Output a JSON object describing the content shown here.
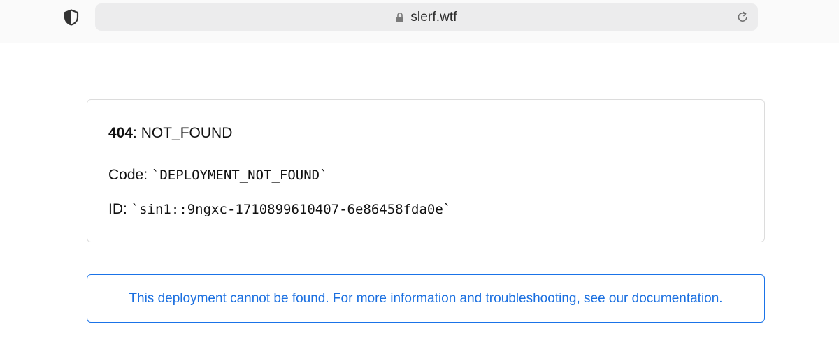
{
  "browser": {
    "url": "slerf.wtf",
    "icons": {
      "shield": "shield-icon",
      "lock": "lock-icon",
      "reload": "reload-icon"
    }
  },
  "error": {
    "status_code": "404",
    "status_separator": ": ",
    "status_text": "NOT_FOUND",
    "code_label": "Code: ",
    "code_value": "`DEPLOYMENT_NOT_FOUND`",
    "id_label": "ID: ",
    "id_value": "`sin1::9ngxc-1710899610407-6e86458fda0e`"
  },
  "notice": {
    "text": "This deployment cannot be found. For more information and troubleshooting, see our documentation."
  },
  "colors": {
    "accent": "#1a73e8",
    "notice_text": "#1a6fe0",
    "toolbar_bg": "#fafafa",
    "urlbar_bg": "#ececed"
  }
}
